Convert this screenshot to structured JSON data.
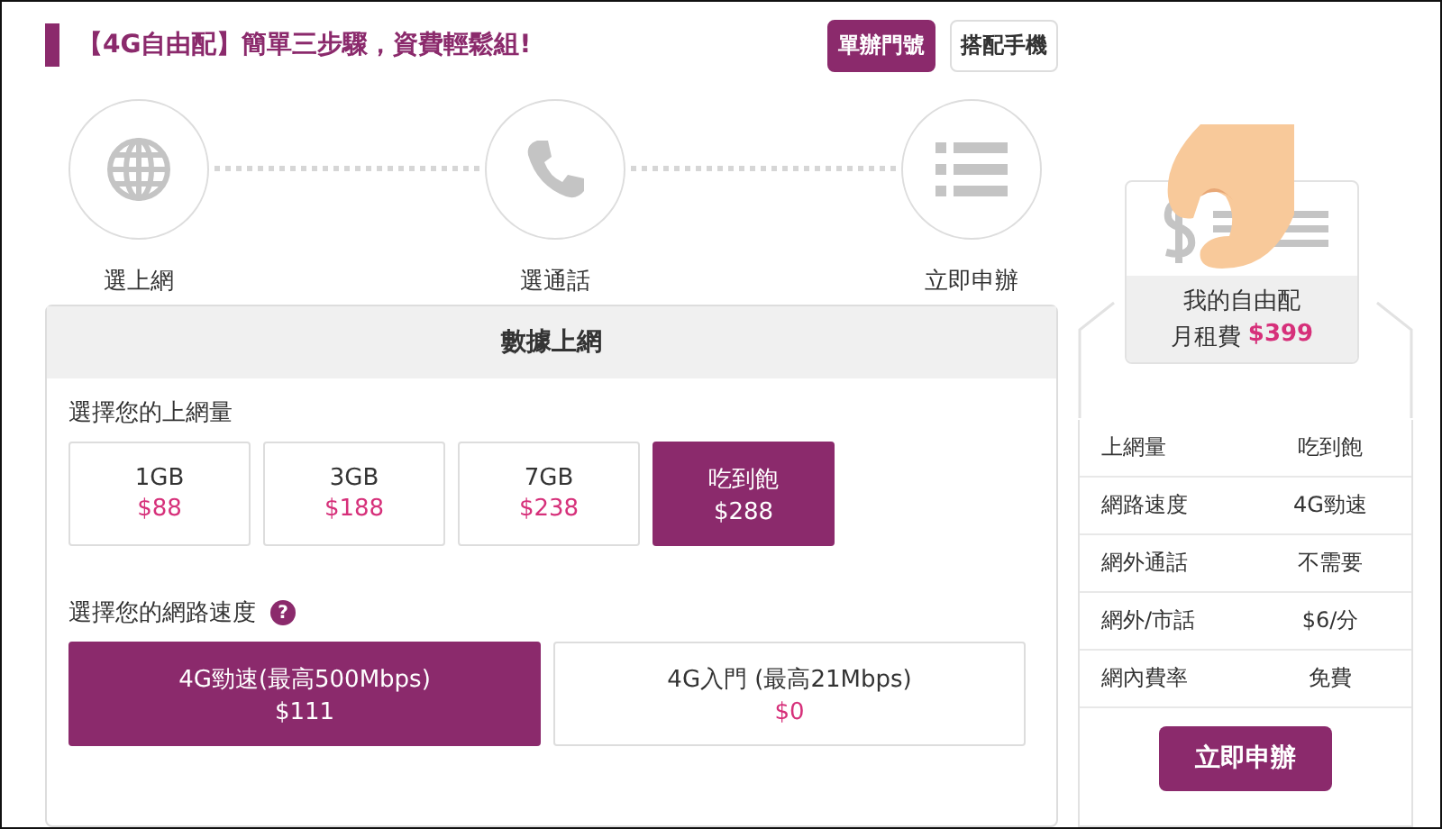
{
  "header": {
    "title": "【4G自由配】簡單三步驟，資費輕鬆組!"
  },
  "mode_tabs": [
    {
      "label": "單辦門號",
      "selected": true
    },
    {
      "label": "搭配手機",
      "selected": false
    }
  ],
  "steps": [
    {
      "kind": "globe",
      "label": "選上網"
    },
    {
      "kind": "phone",
      "label": "選通話"
    },
    {
      "kind": "list",
      "label": "立即申辦"
    }
  ],
  "panel": {
    "title": "數據上網",
    "data_label": "選擇您的上網量",
    "data_options": [
      {
        "name": "1GB",
        "price": "$88",
        "selected": false
      },
      {
        "name": "3GB",
        "price": "$188",
        "selected": false
      },
      {
        "name": "7GB",
        "price": "$238",
        "selected": false
      },
      {
        "name": "吃到飽",
        "price": "$288",
        "selected": true
      }
    ],
    "speed_label": "選擇您的網路速度",
    "speed_help": "?",
    "speed_options": [
      {
        "name": "4G勁速(最高500Mbps)",
        "price": "$111",
        "selected": true
      },
      {
        "name": "4G入門 (最高21Mbps)",
        "price": "$0",
        "selected": false
      }
    ]
  },
  "summary": {
    "card_title": "我的自由配",
    "fee_label": "月租費",
    "fee": "$399",
    "rows": [
      {
        "label": "上網量",
        "value": "吃到飽"
      },
      {
        "label": "網路速度",
        "value": "4G勁速"
      },
      {
        "label": "網外通話",
        "value": "不需要"
      },
      {
        "label": "網外/市話",
        "value": "$6/分"
      },
      {
        "label": "網內費率",
        "value": "免費"
      }
    ],
    "apply_button": "立即申辦"
  }
}
